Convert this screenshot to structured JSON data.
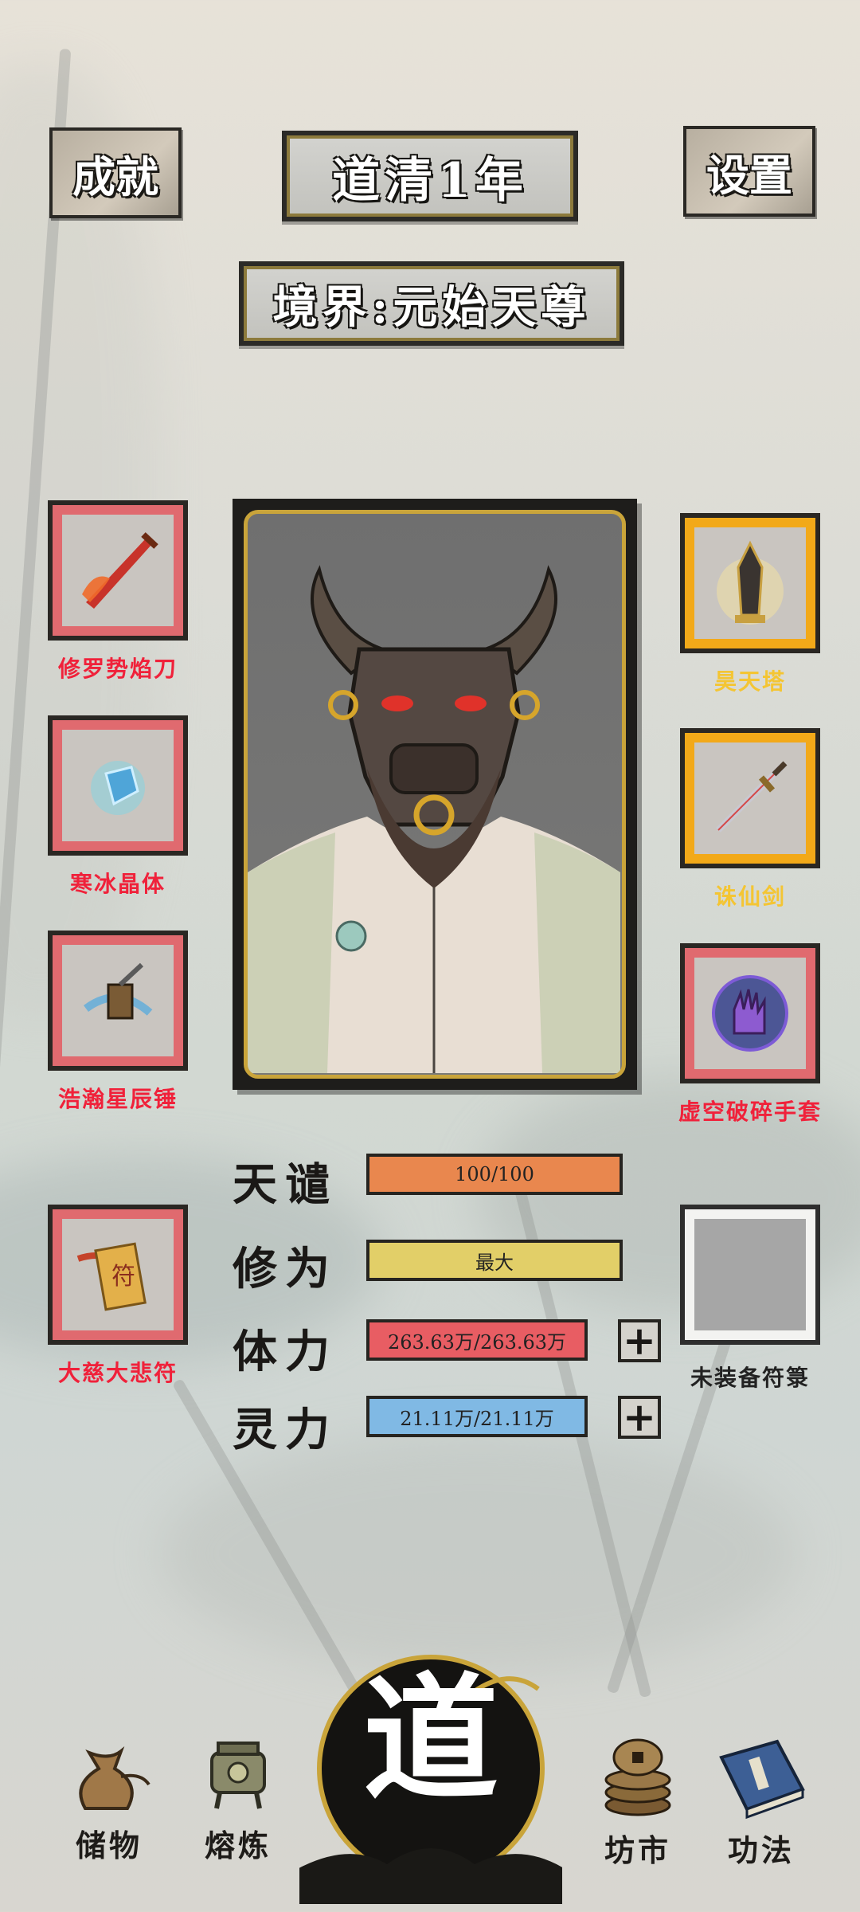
{
  "header": {
    "achievements_label": "成就",
    "year_label": "道清1年",
    "settings_label": "设置",
    "realm_label": "境界:元始天尊"
  },
  "left_equipment": [
    {
      "name": "修罗势焰刀",
      "icon": "flame-blade-icon",
      "rarity_color": "#e06a6f"
    },
    {
      "name": "寒冰晶体",
      "icon": "ice-crystal-icon",
      "rarity_color": "#e06a6f"
    },
    {
      "name": "浩瀚星辰锤",
      "icon": "star-hammer-icon",
      "rarity_color": "#e06a6f"
    },
    {
      "name": "大慈大悲符",
      "icon": "talisman-icon",
      "rarity_color": "#e06a6f"
    }
  ],
  "right_equipment": [
    {
      "name": "昊天塔",
      "icon": "pagoda-icon",
      "rarity_color": "#f2a919"
    },
    {
      "name": "诛仙剑",
      "icon": "immortal-sword-icon",
      "rarity_color": "#f2a919"
    },
    {
      "name": "虚空破碎手套",
      "icon": "void-glove-icon",
      "rarity_color": "#e06a6f"
    },
    {
      "name": "未装备符箓",
      "icon": "empty-slot-icon",
      "rarity_color": "#f3f3f1"
    }
  ],
  "stats": {
    "tribulation": {
      "label": "天谴",
      "value": "100/100",
      "color": "#e9874e"
    },
    "cultivation": {
      "label": "修为",
      "value": "最大",
      "color": "#e2cf68"
    },
    "stamina": {
      "label": "体力",
      "value": "263.63万/263.63万",
      "color": "#e85d63"
    },
    "spirit": {
      "label": "灵力",
      "value": "21.11万/21.11万",
      "color": "#80b9e4"
    }
  },
  "nav": {
    "storage": "储物",
    "smelt": "熔炼",
    "dao": "道",
    "market": "坊市",
    "techniques": "功法"
  }
}
